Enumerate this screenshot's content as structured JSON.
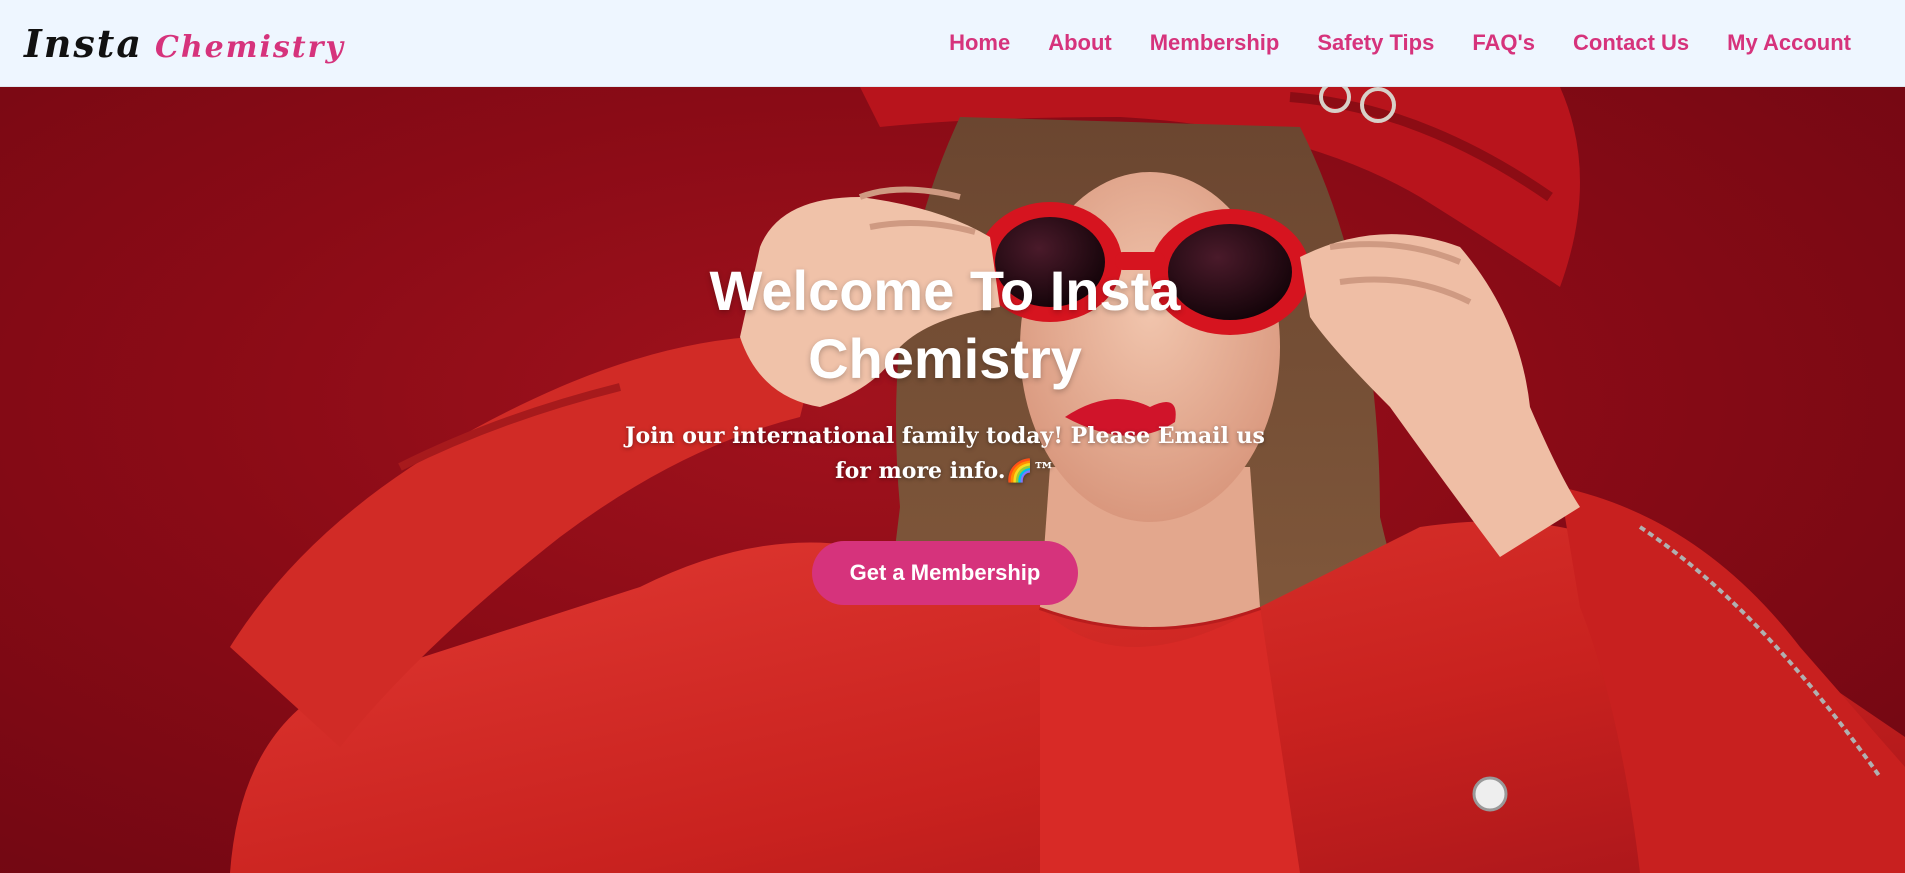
{
  "brand": {
    "first": "Insta",
    "second": "Chemistry"
  },
  "nav": [
    {
      "label": "Home"
    },
    {
      "label": "About"
    },
    {
      "label": "Membership"
    },
    {
      "label": "Safety Tips"
    },
    {
      "label": "FAQ's"
    },
    {
      "label": "Contact Us"
    },
    {
      "label": "My Account"
    }
  ],
  "hero": {
    "title": "Welcome To Insta Chemistry",
    "subtitle": "Join our international family today! Please Email us for more info.🌈™",
    "cta_label": "Get a Membership",
    "image": "woman-in-red-leather-jacket-and-red-sunglasses"
  },
  "colors": {
    "accent": "#d6337c",
    "nav_bg": "#eef6ff",
    "hero_bg": "#8a0b16"
  }
}
